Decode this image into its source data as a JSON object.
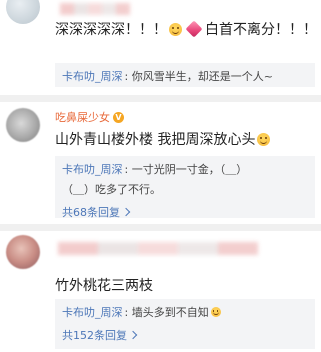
{
  "comments": [
    {
      "text_part1": "深深深深深！！！",
      "text_part2": "白首不离分！！！",
      "replies": [
        {
          "author": "卡布叻_周深",
          "text": ": 你风雪半生，却还是一个人~"
        }
      ]
    },
    {
      "username": "吃鼻屎少女",
      "text": "山外青山楼外楼 我把周深放心头",
      "replies": [
        {
          "author": "卡布叻_周深",
          "text_line1": ": 一寸光阴一寸金，（＿）",
          "text_line2": "（＿）吃多了不行。"
        }
      ],
      "reply_count": "共68条回复"
    },
    {
      "text": "竹外桃花三两枝",
      "replies": [
        {
          "author": "卡布叻_周深",
          "text": ": 墙头多到不自知"
        }
      ],
      "reply_count": "共152条回复"
    }
  ],
  "colors": {
    "username": "#e8693a",
    "reply_author": "#4d77b8",
    "reply_bg": "#f3f4f6",
    "divider": "#f0f0f0"
  }
}
